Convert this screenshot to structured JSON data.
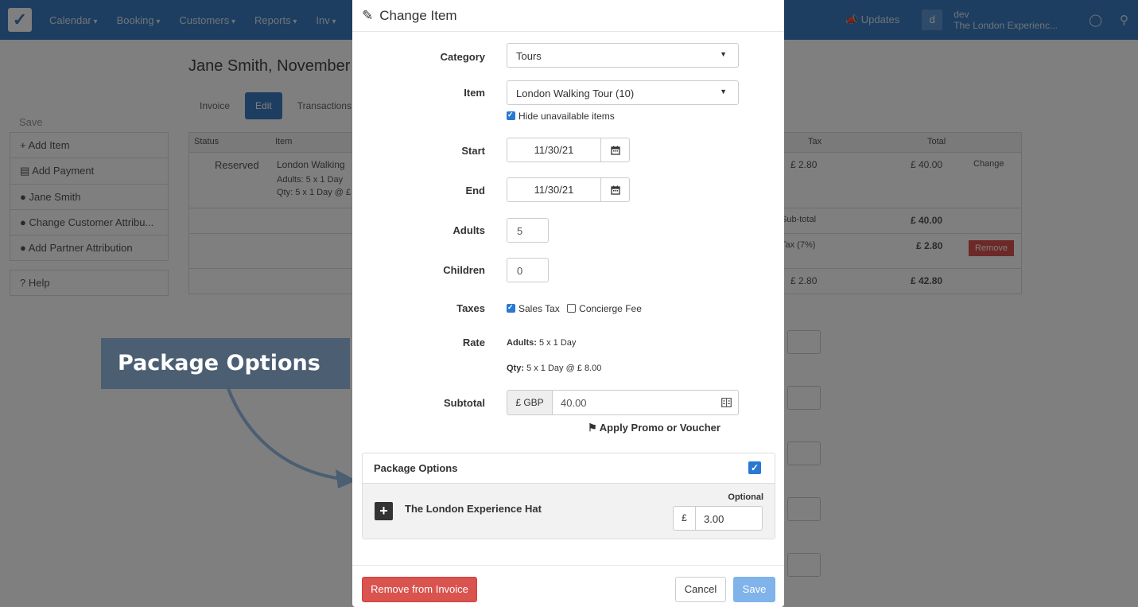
{
  "navbar": {
    "menu": [
      "Calendar",
      "Booking",
      "Customers",
      "Reports",
      "Inv"
    ],
    "updates": "Updates",
    "avatar_letter": "d",
    "user_name": "dev",
    "user_company": "The London Experienc..."
  },
  "background": {
    "page_title": "Jane Smith, November",
    "tabs": [
      "Invoice",
      "Edit",
      "Transactions"
    ],
    "sidebar_head": "Save",
    "sidebar_items": [
      "Add Item",
      "Add Payment",
      "Jane Smith",
      "Change Customer Attribu...",
      "Add Partner Attribution",
      "Help"
    ],
    "table": {
      "headers": {
        "status": "Status",
        "item": "Item",
        "tax": "Tax",
        "total": "Total"
      },
      "status": "Reserved",
      "item": "London Walking",
      "item_adults": "Adults: 5 x 1 Day",
      "item_qty": "Qty: 5 x 1 Day @ £",
      "tax": "£ 2.80",
      "total": "£ 40.00",
      "change": "Change",
      "subtotal_label": "Sub-total",
      "subtotal": "£ 40.00",
      "tax_label": "Tax (7%)",
      "tax_value": "£ 2.80",
      "remove": "Remove",
      "tax_total": "£ 2.80",
      "grand_total": "£ 42.80"
    }
  },
  "callout": {
    "text": "Package Options"
  },
  "modal": {
    "title": "Change Item",
    "category": {
      "label": "Category",
      "value": "Tours"
    },
    "item": {
      "label": "Item",
      "value": "London Walking Tour (10)",
      "hide_unavailable": "Hide unavailable items"
    },
    "start": {
      "label": "Start",
      "value": "11/30/21"
    },
    "end": {
      "label": "End",
      "value": "11/30/21"
    },
    "adults": {
      "label": "Adults",
      "value": "5"
    },
    "children": {
      "label": "Children",
      "value": "0"
    },
    "taxes": {
      "label": "Taxes",
      "sales_tax": "Sales Tax",
      "concierge_fee": "Concierge Fee"
    },
    "rate": {
      "label": "Rate",
      "adults_label": "Adults:",
      "adults_value": "5 x 1 Day",
      "qty_label": "Qty:",
      "qty_value": "5 x 1 Day @ £ 8.00"
    },
    "subtotal": {
      "label": "Subtotal",
      "currency": "£ GBP",
      "value": "40.00"
    },
    "promo": "Apply Promo or Voucher",
    "package": {
      "title": "Package Options",
      "item_name": "The London Experience Hat",
      "optional_label": "Optional",
      "currency": "£",
      "price": "3.00"
    },
    "footer": {
      "remove": "Remove from Invoice",
      "cancel": "Cancel",
      "save": "Save"
    }
  }
}
